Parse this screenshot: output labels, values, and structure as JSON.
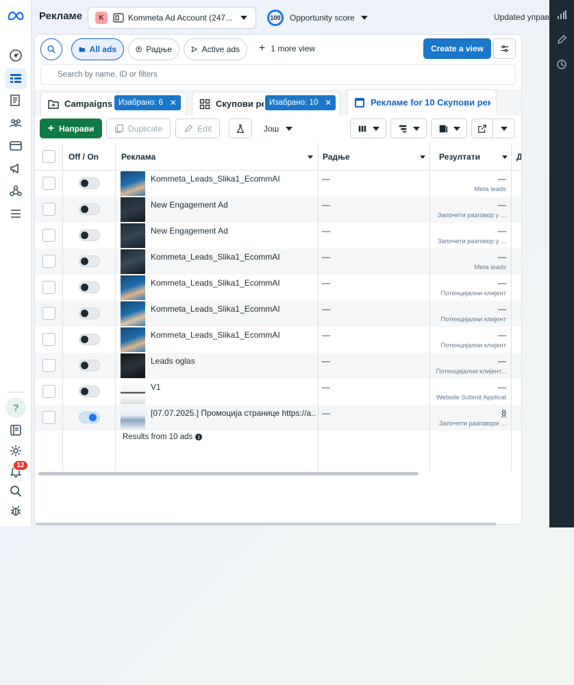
{
  "header": {
    "title": "Рекламе",
    "account_badge": "K",
    "account_name": "Kommeta Ad Account (247...",
    "opportunity_value": "100",
    "opportunity_label": "Opportunity score",
    "updated_text": "Updated управ"
  },
  "leftnav": {
    "notification_count": "12",
    "help_glyph": "?"
  },
  "views": {
    "all_ads": "All ads",
    "active_view": "Радње",
    "active_ads": "Active ads",
    "more_view": "1 more view",
    "create_view": "Create a view"
  },
  "search": {
    "placeholder": "Search by name, ID or filters"
  },
  "tabs": {
    "campaigns": "Campaigns",
    "campaigns_chip": "Изабрано: 6",
    "adsets": "Скупови ре",
    "adsets_chip": "Изабрано: 10",
    "ads": "Рекламе for 10 Скупови рек"
  },
  "toolbar": {
    "create": "Направи",
    "duplicate": "Duplicate",
    "edit": "Edit",
    "more": "Још"
  },
  "table": {
    "headers": {
      "off_on": "Off / On",
      "ad": "Реклама",
      "actions": "Радње",
      "results": "Резултати",
      "next": "Д"
    },
    "rows": [
      {
        "name": "Kommeta_Leads_Slika1_EcommAI",
        "actions": "—",
        "result": "—",
        "result_type": "Meta leads",
        "on": false
      },
      {
        "name": "New Engagement Ad",
        "actions": "—",
        "result": "—",
        "result_type": "Започети разговор у ...",
        "on": false
      },
      {
        "name": "New Engagement Ad",
        "actions": "—",
        "result": "—",
        "result_type": "Започети разговор у ...",
        "on": false
      },
      {
        "name": "Kommeta_Leads_Slika1_EcommAI",
        "actions": "—",
        "result": "—",
        "result_type": "Meta leads",
        "on": false
      },
      {
        "name": "Kommeta_Leads_Slika1_EcommAI",
        "actions": "—",
        "result": "—",
        "result_type": "Потенцијални клијент",
        "on": false
      },
      {
        "name": "Kommeta_Leads_Slika1_EcommAI",
        "actions": "—",
        "result": "—",
        "result_type": "Потенцијални клијент",
        "on": false
      },
      {
        "name": "Kommeta_Leads_Slika1_EcommAI",
        "actions": "—",
        "result": "—",
        "result_type": "Потенцијални клијент",
        "on": false
      },
      {
        "name": "Leads oglas",
        "actions": "—",
        "result": "—",
        "result_type": "Потенцијални клијент...",
        "on": false
      },
      {
        "name": "V1",
        "actions": "—",
        "result": "—",
        "result_type": "Website Submit Applicat",
        "on": false
      },
      {
        "name": "[07.07.2025.] Промоција странице https://a...",
        "actions": "—",
        "result": "8",
        "result_type": "Започети разговори ...",
        "on": true
      }
    ],
    "footer": "Results from 10 ads"
  },
  "colors": {
    "primary": "#1a77c9",
    "create_green": "#0f7a43",
    "rail_dark": "#1c2b33"
  }
}
